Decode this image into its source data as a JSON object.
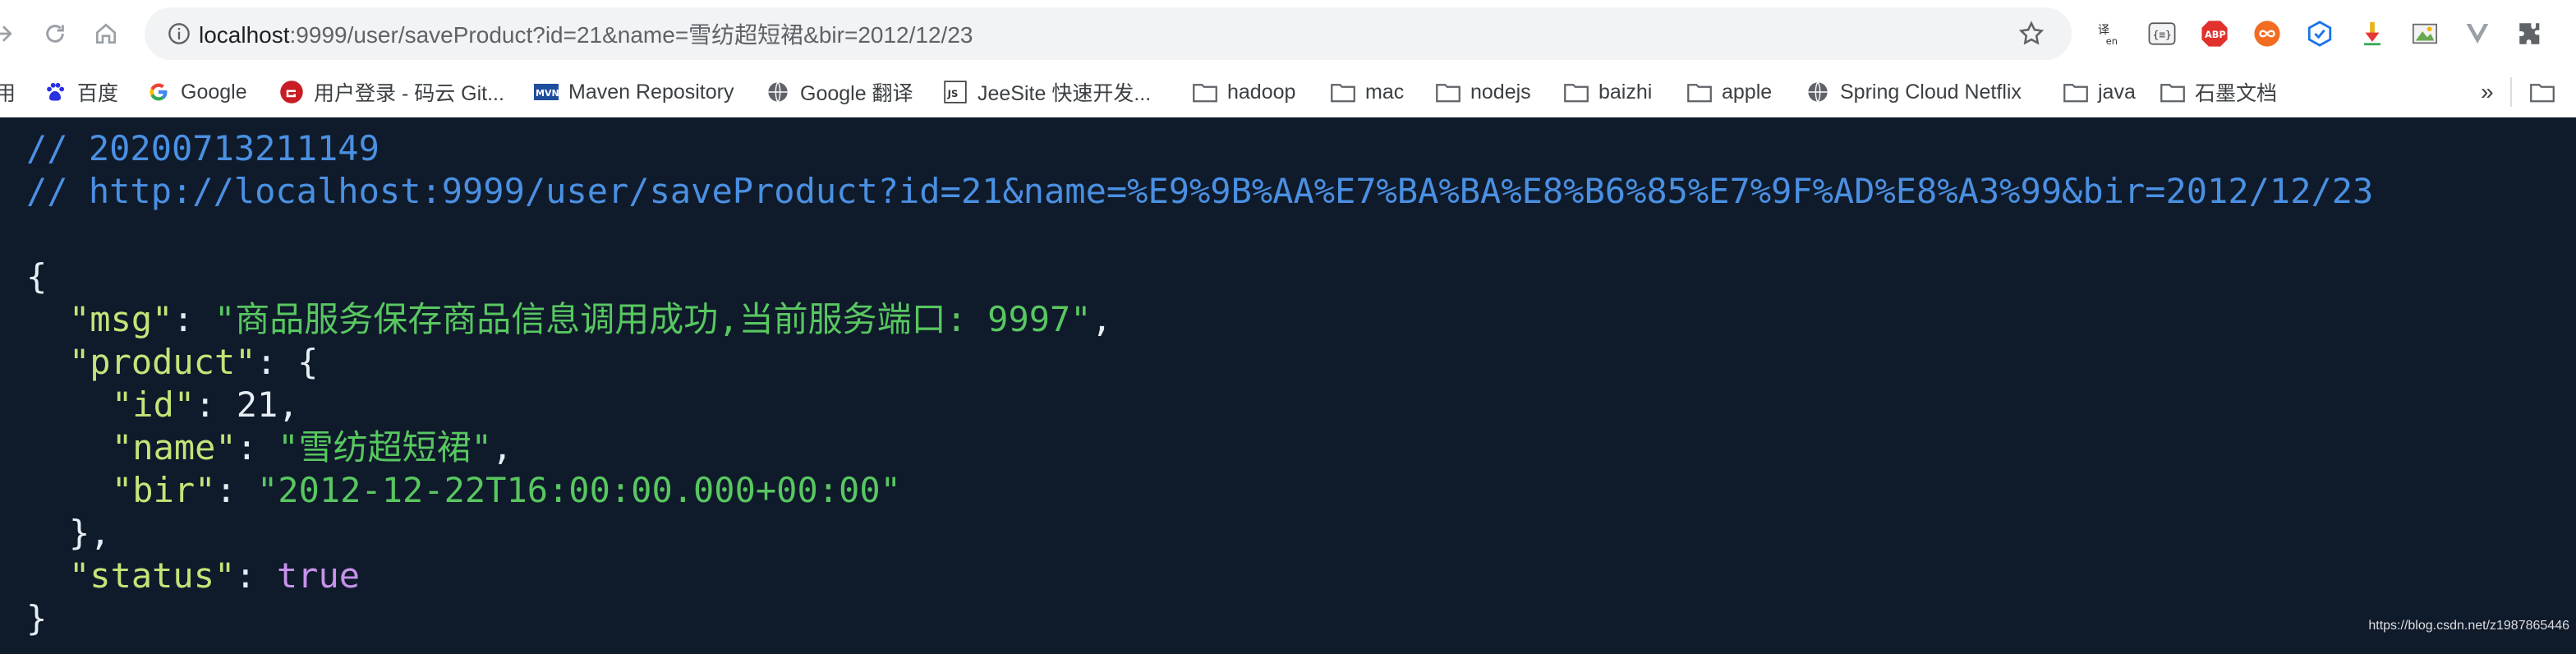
{
  "toolbar": {
    "url_host": "localhost",
    "url_rest": ":9999/user/saveProduct?id=21&name=雪纺超短裙&bir=2012/12/23"
  },
  "bookmarks": [
    {
      "label": "用",
      "icon": "folder-icon"
    },
    {
      "label": "百度",
      "icon": "baidu-icon"
    },
    {
      "label": "Google",
      "icon": "google-icon"
    },
    {
      "label": "用户登录 - 码云 Git...",
      "icon": "gitee-icon"
    },
    {
      "label": "Maven Repository",
      "icon": "maven-icon"
    },
    {
      "label": "Google 翻译",
      "icon": "globe-icon"
    },
    {
      "label": "JeeSite 快速开发...",
      "icon": "js-icon"
    },
    {
      "label": "hadoop",
      "icon": "folder-icon"
    },
    {
      "label": "mac",
      "icon": "folder-icon"
    },
    {
      "label": "nodejs",
      "icon": "folder-icon"
    },
    {
      "label": "baizhi",
      "icon": "folder-icon"
    },
    {
      "label": "apple",
      "icon": "folder-icon"
    },
    {
      "label": "Spring Cloud Netflix",
      "icon": "globe-icon"
    },
    {
      "label": "java",
      "icon": "folder-icon"
    },
    {
      "label": "石墨文档",
      "icon": "folder-icon"
    },
    {
      "label": "»",
      "icon": "more-icon"
    }
  ],
  "json_view": {
    "comment_time": "// 20200713211149",
    "comment_url": "// http://localhost:9999/user/saveProduct?id=21&name=%E9%9B%AA%E7%BA%BA%E8%B6%85%E7%9F%AD%E8%A3%99&bir=2012/12/23",
    "open_brace": "{",
    "msg_key": "\"msg\"",
    "msg_value": "\"商品服务保存商品信息调用成功,当前服务端口: 9997\"",
    "product_key": "\"product\"",
    "id_key": "\"id\"",
    "id_value": "21",
    "name_key": "\"name\"",
    "name_value": "\"雪纺超短裙\"",
    "bir_key": "\"bir\"",
    "bir_value": "\"2012-12-22T16:00:00.000+00:00\"",
    "product_close": "},",
    "status_key": "\"status\"",
    "status_value": "true",
    "close_brace": "}"
  },
  "watermark": "https://blog.csdn.net/z1987865446",
  "colors": {
    "background": "#0f1a2b",
    "comment": "#4a90e2",
    "key": "#c5e478",
    "string": "#58c760",
    "boolean": "#c792ea"
  }
}
